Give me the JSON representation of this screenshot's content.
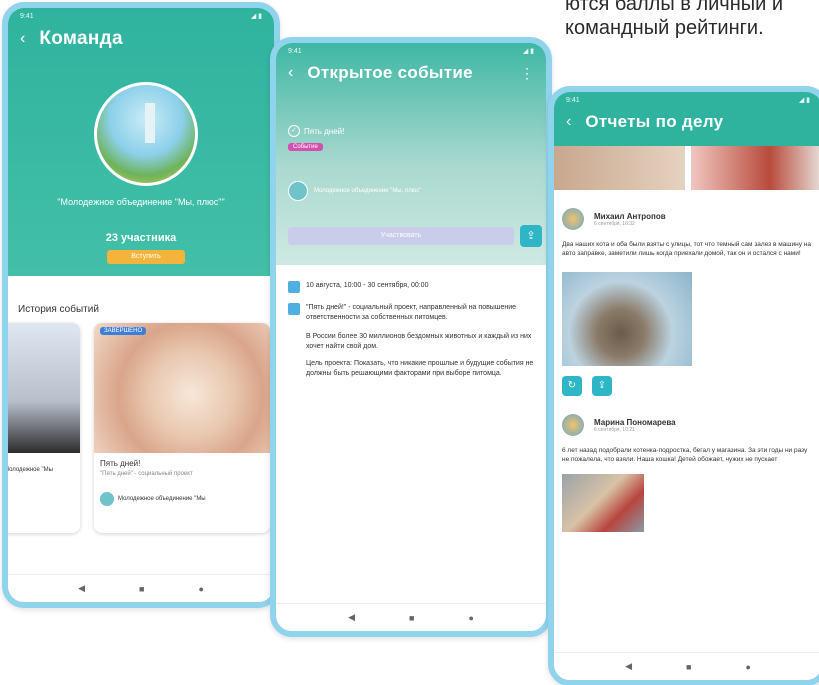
{
  "caption": "ются баллы в личный и командный рейтинги.",
  "team": {
    "title": "Команда",
    "name": "\"Молодежное объединение \"Мы, плюс\"\"",
    "members": "23 участника",
    "join": "Вступить",
    "history_title": "История событий",
    "cards": [
      {
        "tag": "",
        "title": "",
        "desc": "",
        "org": "Молодежное \"Мы"
      },
      {
        "tag": "ЗАВЕРШЕНО",
        "title": "Пять дней!",
        "desc": "\"Пять дней\" - социальный проект",
        "org": "Молодежное объединение \"Мы"
      }
    ]
  },
  "event": {
    "title": "Открытое событие",
    "tag_label": "Пять дней!",
    "pill": "Событие",
    "org": "Молодежное объединение \"Мы, плюс\"",
    "join_label": "Участвовать",
    "dates": "10 августа, 10:00 - 30 сентября, 00:00",
    "description": [
      "\"Пять дней!\" - социальный проект, направленный на повышение ответственности за собственных питомцев.",
      "В России более 30 миллионов бездомных животных и каждый из них хочет найти свой дом.",
      "Цель проекта: Показать, что никакие прошлые и будущие события не должны быть решающими факторами при выборе питомца."
    ]
  },
  "reports": {
    "title": "Отчеты по делу",
    "items": [
      {
        "author": "Михаил Антропов",
        "time": "6 сентября, 10:32",
        "text": "Два наших кота и оба были взяты с улицы, тот что темный сам залез в машину на авто заправке, заметили лишь когда приехали домой, так он и остался с нами!"
      },
      {
        "author": "Марина Пономарева",
        "time": "6 сентября, 10:21",
        "text": "6 лет назад подобрали котенка-подростка, бегал у магазина. За эти годы ни разу не пожалела, что взяли. Наша кошка! Детей обожает, чужих не пускает"
      }
    ]
  },
  "nav": {
    "back": "◀",
    "home": "●",
    "recent": "■"
  },
  "status": {
    "time": "9:41",
    "signal": "◢ ▮"
  }
}
